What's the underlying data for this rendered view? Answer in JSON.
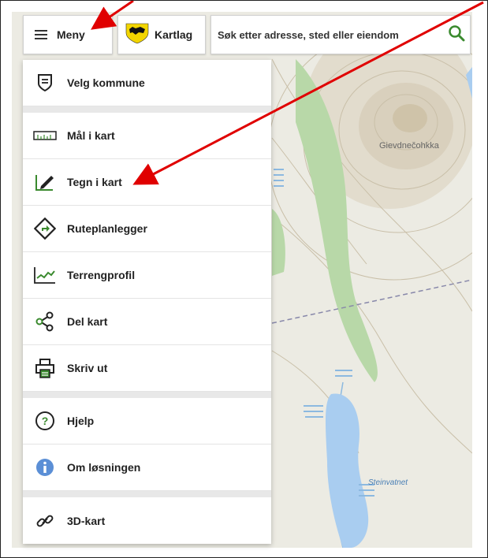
{
  "topbar": {
    "menu_label": "Meny",
    "layers_label": "Kartlag",
    "search_placeholder": "Søk etter adresse, sted eller eiendom"
  },
  "menu": {
    "items": [
      {
        "label": "Velg kommune",
        "icon": "shield-icon"
      },
      {
        "label": "Mål i kart",
        "icon": "ruler-icon"
      },
      {
        "label": "Tegn i kart",
        "icon": "pencil-draw-icon"
      },
      {
        "label": "Ruteplanlegger",
        "icon": "route-sign-icon"
      },
      {
        "label": "Terrengprofil",
        "icon": "terrain-profile-icon"
      },
      {
        "label": "Del kart",
        "icon": "share-icon"
      },
      {
        "label": "Skriv ut",
        "icon": "printer-icon"
      },
      {
        "label": "Hjelp",
        "icon": "help-icon"
      },
      {
        "label": "Om løsningen",
        "icon": "info-icon"
      },
      {
        "label": "3D-kart",
        "icon": "link-icon"
      }
    ]
  },
  "map": {
    "place_name": "Gievdnečohkka",
    "lake_name": "Steinvatnet"
  },
  "colors": {
    "accent_green": "#3a8a2e",
    "annotation_red": "#e00000",
    "water": "#a9cdf0",
    "forest": "#b8d8a8"
  }
}
